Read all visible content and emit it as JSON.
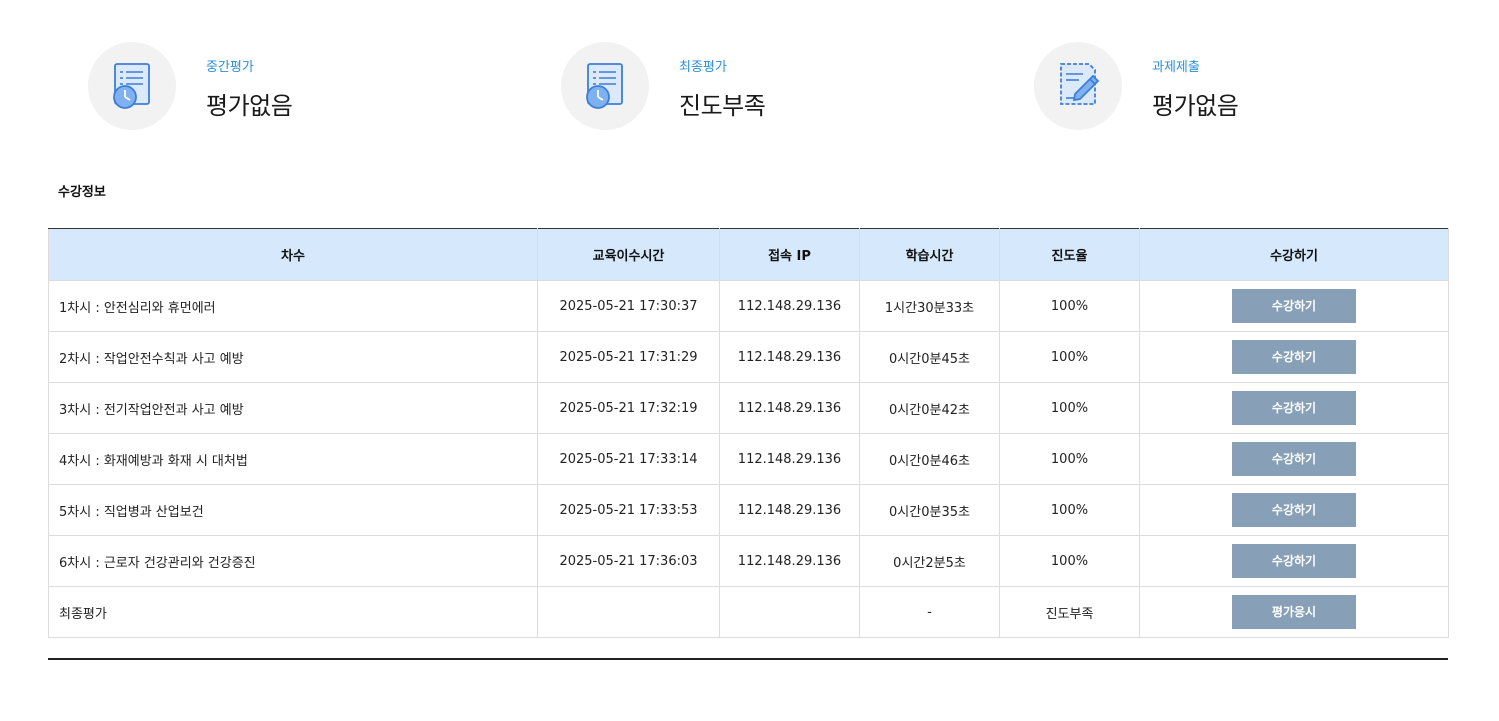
{
  "evaluations": [
    {
      "label": "중간평가",
      "value": "평가없음",
      "icon": "exam-clock-icon"
    },
    {
      "label": "최종평가",
      "value": "진도부족",
      "icon": "exam-clock-icon"
    },
    {
      "label": "과제제출",
      "value": "평가없음",
      "icon": "assignment-pen-icon"
    }
  ],
  "section_title": "수강정보",
  "table": {
    "headers": [
      "차수",
      "교육이수시간",
      "접속 IP",
      "학습시간",
      "진도율",
      "수강하기"
    ],
    "rows": [
      {
        "title": "1차시 : 안전심리와 휴먼에러",
        "completed_at": "2025-05-21 17:30:37",
        "ip": "112.148.29.136",
        "study_time": "1시간30분33초",
        "progress": "100%",
        "action": "수강하기"
      },
      {
        "title": "2차시 : 작업안전수칙과 사고 예방",
        "completed_at": "2025-05-21 17:31:29",
        "ip": "112.148.29.136",
        "study_time": "0시간0분45초",
        "progress": "100%",
        "action": "수강하기"
      },
      {
        "title": "3차시 : 전기작업안전과 사고 예방",
        "completed_at": "2025-05-21 17:32:19",
        "ip": "112.148.29.136",
        "study_time": "0시간0분42초",
        "progress": "100%",
        "action": "수강하기"
      },
      {
        "title": "4차시 : 화재예방과 화재 시 대처법",
        "completed_at": "2025-05-21 17:33:14",
        "ip": "112.148.29.136",
        "study_time": "0시간0분46초",
        "progress": "100%",
        "action": "수강하기"
      },
      {
        "title": "5차시 : 직업병과 산업보건",
        "completed_at": "2025-05-21 17:33:53",
        "ip": "112.148.29.136",
        "study_time": "0시간0분35초",
        "progress": "100%",
        "action": "수강하기"
      },
      {
        "title": "6차시 : 근로자 건강관리와 건강증진",
        "completed_at": "2025-05-21 17:36:03",
        "ip": "112.148.29.136",
        "study_time": "0시간2분5초",
        "progress": "100%",
        "action": "수강하기"
      },
      {
        "title": "최종평가",
        "completed_at": "",
        "ip": "",
        "study_time": "-",
        "progress": "진도부족",
        "action": "평가응시"
      }
    ]
  },
  "colors": {
    "accent": "#2b8fd8",
    "header_bg": "#d6e8fb",
    "button_bg": "#87a0b7"
  }
}
